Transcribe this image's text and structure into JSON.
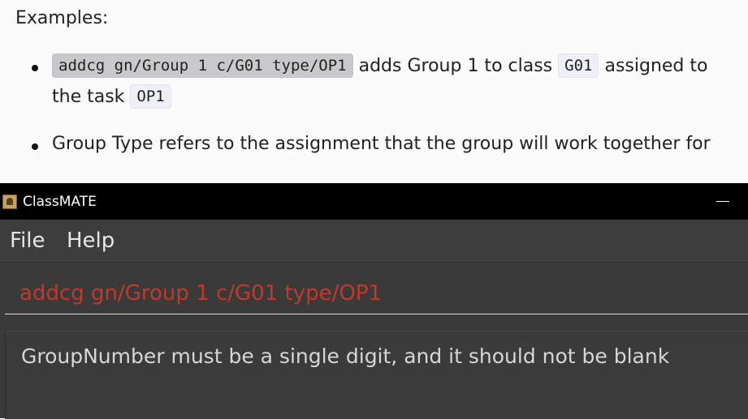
{
  "doc": {
    "heading": "Examples:",
    "example1": {
      "code": "addcg gn/Group 1 c/G01 type/OP1",
      "text1": "adds Group 1 to class",
      "code2": "G01",
      "text2": "assigned to",
      "text3": "the task",
      "code3": "OP1"
    },
    "example2": {
      "text": "Group Type refers to the assignment that the group will work together for"
    }
  },
  "window": {
    "title": "ClassMATE",
    "menu": [
      "File",
      "Help"
    ],
    "command_input": "addcg gn/Group 1 c/G01 type/OP1",
    "result": "GroupNumber must be a single digit, and it should not be blank"
  },
  "colors": {
    "command_text": "#c0392b",
    "window_bg": "#3a3a3a",
    "titlebar_bg": "#000000"
  },
  "icons": {
    "app": "app-icon",
    "minimize": "minimize-icon"
  }
}
